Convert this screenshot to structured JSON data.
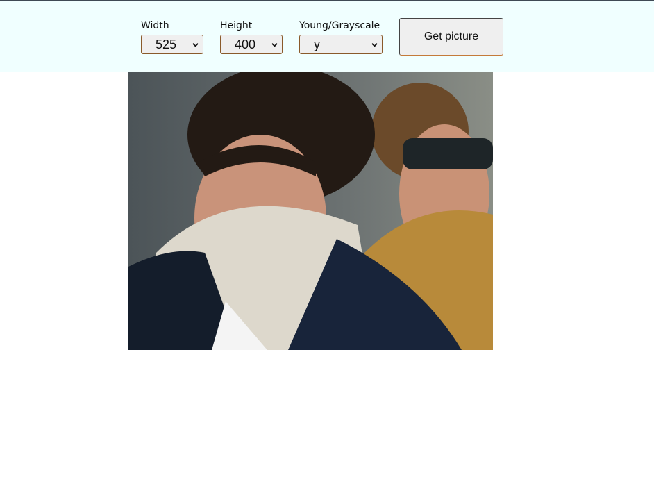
{
  "controls": {
    "width": {
      "label": "Width",
      "value": "525"
    },
    "height": {
      "label": "Height",
      "value": "400"
    },
    "young": {
      "label": "Young/Grayscale",
      "value": "y"
    },
    "button_label": "Get picture"
  },
  "photo": {
    "description_icon": "portrait-photo"
  },
  "colors": {
    "toolbar_bg": "#f0ffff",
    "top_border": "#3f4a55"
  }
}
